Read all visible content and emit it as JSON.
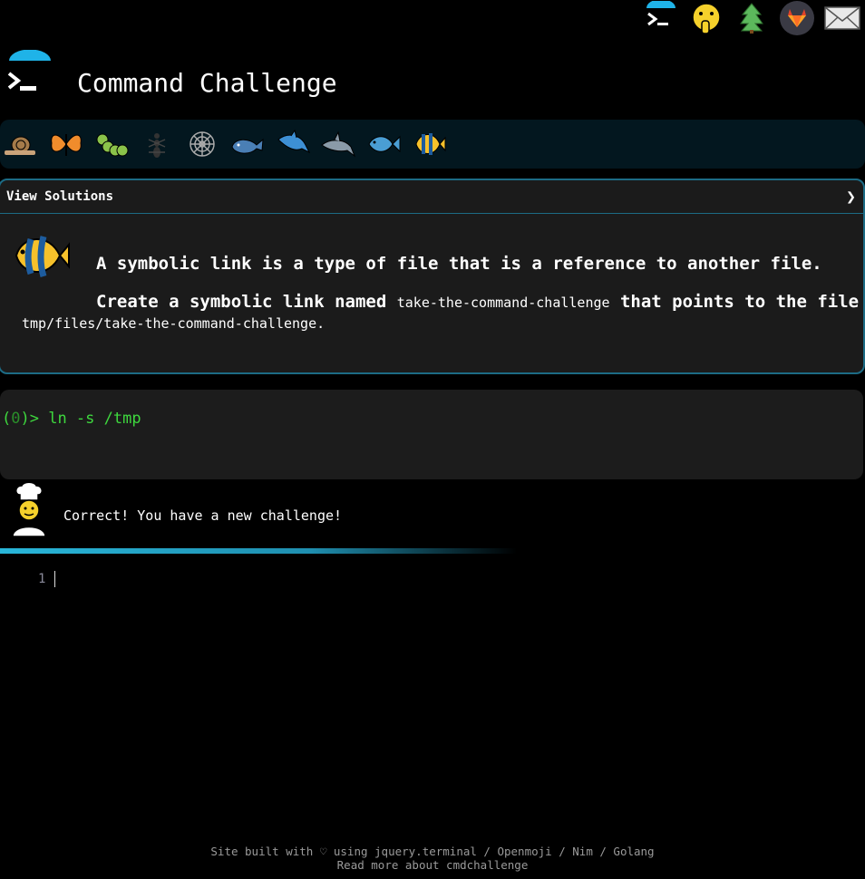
{
  "header": {
    "title": "Command Challenge"
  },
  "top_icons": [
    "terminal-umbrella-icon",
    "shushing-face-icon",
    "tree-icon",
    "gitlab-icon",
    "mail-icon"
  ],
  "animals": [
    "snail-icon",
    "butterfly-icon",
    "caterpillar-icon",
    "ant-icon",
    "spider-web-icon",
    "whale-icon",
    "dolphin-icon",
    "shark-icon",
    "fish-icon",
    "tropical-fish-icon"
  ],
  "card": {
    "view_solutions": "View Solutions",
    "chevron": "❯",
    "line1": "A symbolic link is a type of file that is a reference to another file.",
    "line2_prefix": "Create a symbolic link named ",
    "line2_code": "take-the-command-challenge",
    "line2_suffix": " that points to the file",
    "line3": "tmp/files/take-the-command-challenge."
  },
  "terminal": {
    "prompt_open": "(",
    "prompt_zero": "0",
    "prompt_close": ")>",
    "command": " ln -s /tmp"
  },
  "result": {
    "text": "Correct! You have a new challenge!"
  },
  "editor": {
    "line_number": "1"
  },
  "footer": {
    "line1": "Site built with ♡ using jquery.terminal / Openmoji / Nim / Golang",
    "line2": "Read more about cmdchallenge"
  },
  "colors": {
    "accent": "#1c6b85",
    "prompt_green": "#3ed83e",
    "bar_bg": "#03171f"
  }
}
